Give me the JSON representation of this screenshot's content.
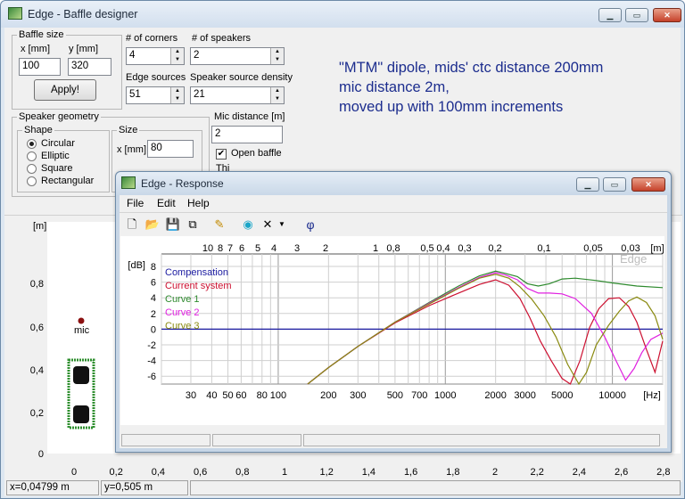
{
  "main_window": {
    "title": "Edge - Baffle designer",
    "baffle_size": {
      "group_label": "Baffle size",
      "x_label": "x [mm]",
      "y_label": "y [mm]",
      "x_value": "100",
      "y_value": "320",
      "apply_label": "Apply!"
    },
    "corners": {
      "label": "# of corners",
      "value": "4"
    },
    "speakers": {
      "label": "# of speakers",
      "value": "2"
    },
    "edge_sources": {
      "label": "Edge sources",
      "value": "51"
    },
    "source_density": {
      "label": "Speaker source density",
      "value": "21"
    },
    "mic_distance": {
      "label": "Mic distance [m]",
      "value": "2"
    },
    "open_baffle": {
      "label": "Open baffle",
      "checked": true
    },
    "this_label_partial": "Thi",
    "speaker_geometry": {
      "group_label": "Speaker geometry",
      "shape_label": "Shape",
      "shapes": [
        "Circular",
        "Elliptic",
        "Square",
        "Rectangular"
      ],
      "selected_shape": "Circular",
      "size_label": "Size",
      "x_mm_label": "x [mm]",
      "x_mm_value": "80"
    },
    "annotation": [
      "\"MTM\" dipole, mids' ctc distance 200mm",
      "mic distance 2m,",
      "moved up with 100mm increments"
    ],
    "plot": {
      "y_unit": "[m]",
      "y_ticks": [
        "0,8",
        "0,6",
        "0,4",
        "0,2",
        "0"
      ],
      "x_ticks": [
        "0",
        "0,2",
        "0,4",
        "0,6",
        "0,8",
        "1",
        "1,2",
        "1,4",
        "1,6",
        "1,8",
        "2",
        "2,2",
        "2,4",
        "2,6",
        "2,8"
      ],
      "mic_label": "mic"
    },
    "status": {
      "x": "x=0,04799 m",
      "y": "y=0,505 m"
    },
    "colors": {
      "baffle_green": "#2f8f2f",
      "mic_red": "#8b1010",
      "text_blue": "#1c2d8e"
    }
  },
  "response_window": {
    "title": "Edge - Response",
    "menu": [
      "File",
      "Edit",
      "Help"
    ],
    "toolbar_icons": [
      "new-icon",
      "open-icon",
      "save-icon",
      "copy-icon",
      "pencil-icon",
      "sound-icon",
      "delete-icon",
      "dropdown-icon",
      "phi-icon"
    ],
    "phi_symbol": "φ",
    "watermark": "Edge"
  },
  "chart_data": {
    "type": "line",
    "ylabel": "[dB]",
    "xlabel_unit": "[Hz]",
    "top_axis_unit": "[m]",
    "x_scale": "log",
    "xlim": [
      20,
      20000
    ],
    "ylim": [
      -7,
      8
    ],
    "y_ticks": [
      8,
      6,
      4,
      2,
      0,
      -2,
      -4,
      -6
    ],
    "x_ticks": [
      30,
      40,
      50,
      60,
      80,
      100,
      200,
      300,
      500,
      700,
      1000,
      2000,
      3000,
      5000,
      10000
    ],
    "x_tick_labels": [
      "30",
      "40",
      "50",
      "60",
      "80",
      "100",
      "200",
      "300",
      "500",
      "700",
      "1000",
      "2000",
      "3000",
      "5000",
      "10000"
    ],
    "top_ticks": [
      "10",
      "8",
      "7",
      "6",
      "5",
      "4",
      "3",
      "2",
      "1",
      "0,8",
      "0,5",
      "0,4",
      "0,3",
      "0,2",
      "0,1",
      "0,05",
      "0,03"
    ],
    "legend_placement": "top-left",
    "series": [
      {
        "name": "Compensation",
        "color": "#1a1aa0",
        "x": [
          20,
          20000
        ],
        "y": [
          0,
          0
        ]
      },
      {
        "name": "Current system",
        "color": "#cc1030",
        "x": [
          150,
          200,
          300,
          500,
          800,
          1200,
          1600,
          2000,
          2400,
          2800,
          3200,
          3700,
          4300,
          5000,
          5600,
          6400,
          7300,
          8300,
          9500,
          11000,
          12500,
          14000,
          16000,
          18000,
          20000
        ],
        "y": [
          -7,
          -4.9,
          -2.2,
          0.8,
          3.0,
          4.6,
          5.7,
          6.3,
          5.6,
          3.9,
          1.5,
          -1.5,
          -4.0,
          -6.3,
          -7,
          -4,
          0.2,
          2.6,
          3.9,
          4.0,
          2.9,
          0.9,
          -2.6,
          -5.5,
          -1.5
        ]
      },
      {
        "name": "Curve 1",
        "color": "#2e8a2e",
        "x": [
          150,
          200,
          300,
          500,
          800,
          1200,
          1600,
          2000,
          2300,
          2700,
          3100,
          3600,
          4200,
          5000,
          6000,
          8000,
          10000,
          14000,
          20000
        ],
        "y": [
          -7,
          -4.9,
          -2.2,
          0.9,
          3.4,
          5.5,
          6.8,
          7.4,
          7.1,
          6.7,
          5.8,
          5.5,
          5.8,
          6.4,
          6.5,
          6.2,
          5.9,
          5.5,
          5.3
        ]
      },
      {
        "name": "Curve 2",
        "color": "#e020e0",
        "x": [
          150,
          200,
          300,
          500,
          800,
          1200,
          1600,
          2000,
          2300,
          2700,
          3100,
          3600,
          4200,
          5000,
          6000,
          7500,
          9000,
          10500,
          12000,
          13500,
          15000,
          17000,
          20000
        ],
        "y": [
          -7,
          -4.9,
          -2.2,
          0.9,
          3.3,
          5.3,
          6.6,
          7.2,
          6.9,
          6.3,
          5.2,
          4.6,
          4.6,
          4.5,
          3.9,
          2.0,
          -1.0,
          -4.0,
          -6.5,
          -5.0,
          -3.0,
          -1.3,
          -0.5
        ]
      },
      {
        "name": "Curve 3",
        "color": "#8a8a10",
        "x": [
          150,
          200,
          300,
          500,
          800,
          1200,
          1600,
          2000,
          2400,
          2800,
          3300,
          3900,
          4600,
          5400,
          6300,
          7000,
          8000,
          9500,
          11000,
          12500,
          14000,
          16000,
          18000,
          20000
        ],
        "y": [
          -7,
          -4.9,
          -2.2,
          0.9,
          3.2,
          5.2,
          6.5,
          7.0,
          6.5,
          5.4,
          3.8,
          1.7,
          -1.0,
          -4.5,
          -7,
          -5.5,
          -2.0,
          0.5,
          2.3,
          3.6,
          4.1,
          3.4,
          1.7,
          -1.3
        ]
      }
    ]
  }
}
